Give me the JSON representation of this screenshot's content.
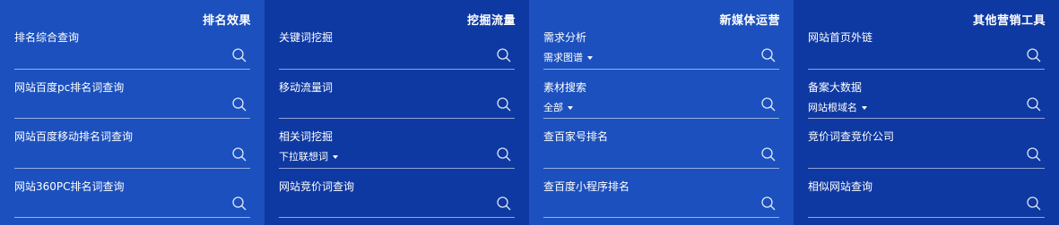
{
  "colors": {
    "panel_light": "#1B50BE",
    "panel_dark": "#0E39A2",
    "text": "#FFFFFF",
    "divider": "#A9BDE8"
  },
  "columns": [
    {
      "title": "排名效果",
      "items": [
        {
          "label": "排名综合查询"
        },
        {
          "label": "网站百度pc排名词查询"
        },
        {
          "label": "网站百度移动排名词查询"
        },
        {
          "label": "网站360PC排名词查询"
        }
      ]
    },
    {
      "title": "挖掘流量",
      "items": [
        {
          "label": "关键词挖掘"
        },
        {
          "label": "移动流量词"
        },
        {
          "label": "相关词挖掘",
          "select": "下拉联想词"
        },
        {
          "label": "网站竞价词查询"
        }
      ]
    },
    {
      "title": "新媒体运营",
      "items": [
        {
          "label": "需求分析",
          "select": "需求图谱"
        },
        {
          "label": "素材搜索",
          "select": "全部"
        },
        {
          "label": "查百家号排名"
        },
        {
          "label": "查百度小程序排名"
        }
      ]
    },
    {
      "title": "其他营销工具",
      "items": [
        {
          "label": "网站首页外链"
        },
        {
          "label": "备案大数据",
          "select": "网站根域名"
        },
        {
          "label": "竞价词查竞价公司"
        },
        {
          "label": "相似网站查询"
        }
      ]
    }
  ],
  "icons": {
    "search": "search-icon",
    "dropdown": "caret-down-icon"
  }
}
